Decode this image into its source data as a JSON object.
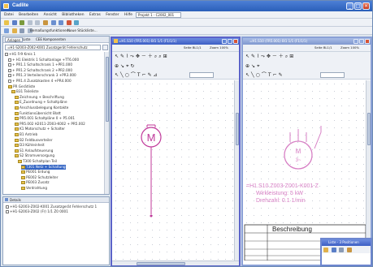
{
  "app": {
    "title": "Cadlite"
  },
  "menu": [
    "Datei",
    "Bearbeiten",
    "Ansicht",
    "Bibliotheken",
    "Extras",
    "Fenster",
    "Hilfe"
  ],
  "project_select": "Projekt 1 - C2002_001",
  "toolbar2": {
    "item1": "Bemaßungsfunktionen...",
    "item2": "Neue Stückliste..."
  },
  "left_panel": {
    "tabs": [
      "Anlagen",
      "Liste",
      "CEE Komponenten"
    ],
    "filter": "=H1-S2003-Z002-K001 Zusatzgerät Fehlerschutz",
    "tree": [
      {
        "text": "+H1 Fr9 Kreis 1",
        "level": 0,
        "type": "box"
      },
      {
        "text": "+ H1 Elektrik 1 Schaltanlage +TT6.000",
        "level": 1,
        "type": "box"
      },
      {
        "text": "+ PR1.1 Schaltschrank 1 +PR1.000",
        "level": 1,
        "type": "box"
      },
      {
        "text": "+ PR1.2 Schaltschrank 2 +PR2.000",
        "level": 1,
        "type": "box"
      },
      {
        "text": "+ PR1.3 Verteilerschrank 3 +PR3.000",
        "level": 1,
        "type": "box"
      },
      {
        "text": "+ PR1.4 Zusatzkasten 4 +PR4.000",
        "level": 1,
        "type": "box"
      },
      {
        "text": "PR Gerätliste",
        "level": 1,
        "type": "folder"
      },
      {
        "text": "B31 Teileliste",
        "level": 2,
        "type": "folder"
      },
      {
        "text": "Zeichnung + Beschriftung",
        "level": 3,
        "type": "folder"
      },
      {
        "text": "E_Zuordnung + Schaltpläne",
        "level": 3,
        "type": "folder"
      },
      {
        "text": "Anschlussbelegung Kontakte",
        "level": 3,
        "type": "folder"
      },
      {
        "text": "Funktionsübersicht Blatt",
        "level": 3,
        "type": "folder"
      },
      {
        "text": "PR5.001 Schaltpläne 0 + P5.001",
        "level": 3,
        "type": "folder"
      },
      {
        "text": "PR5.002 H2011-Z003-K002 + PR5.002",
        "level": 3,
        "type": "folder"
      },
      {
        "text": "K1 Motorschutz + Schalter",
        "level": 3,
        "type": "folder"
      },
      {
        "text": "B1 Antrieb",
        "level": 3,
        "type": "folder"
      },
      {
        "text": "B2 Feldbusverteiler",
        "level": 3,
        "type": "folder"
      },
      {
        "text": "D3 Kühleinheit",
        "level": 3,
        "type": "folder"
      },
      {
        "text": "S1 Anlaufsteuerung",
        "level": 3,
        "type": "folder"
      },
      {
        "text": "S2 Stromversorgung",
        "level": 3,
        "type": "folder"
      },
      {
        "text": "T300 Schaltplan Teil",
        "level": 4,
        "type": "folder"
      },
      {
        "text": "T301 Netz + Schaltung",
        "level": 5,
        "type": "folder"
      },
      {
        "text": "PE001 Erdung",
        "level": 5,
        "type": "folder"
      },
      {
        "text": "PE002 Schutzleiter",
        "level": 5,
        "type": "folder"
      },
      {
        "text": "PE003 Zusatz",
        "level": 5,
        "type": "folder"
      },
      {
        "text": "Verdrahtung",
        "level": 5,
        "type": "folder"
      }
    ]
  },
  "bottom_panel": {
    "title": "Details",
    "rows": [
      "+H1-S2003-Z002-K001 Zusatzgerät Fehlerschutz 1",
      "+H1-S2003-Z002 (Fr) 1/1 Z0 0001"
    ]
  },
  "doc1": {
    "title": "=H1.S10 (FR5.001) Bl1 1/1 (F1/1/1)",
    "page_label": "Seite BL1/1",
    "zoom": "Zoom 100%",
    "symbol_letter": "M"
  },
  "doc2": {
    "title": "=H1.S10 (FR5.001) Bl1 1/1 (F1/1/1)",
    "page_label": "Seite BL1/1",
    "zoom": "Zoom 100%",
    "symbol_letter": "M",
    "symbol_sub": "3~",
    "label_line1": "=H1.S10.Z003-Z001-K001-Z",
    "label_line2": "Wirkleistung: 5 kW",
    "label_line3": "Drehzahl: 0.1 1/min",
    "table_header": "Beschreibung"
  },
  "doc3": {
    "title": "Liste - 3 Positionen"
  },
  "colors": {
    "accent": "#2a5fb9",
    "symbol": "#c0389a",
    "subwin_border": "#5b63c9"
  }
}
